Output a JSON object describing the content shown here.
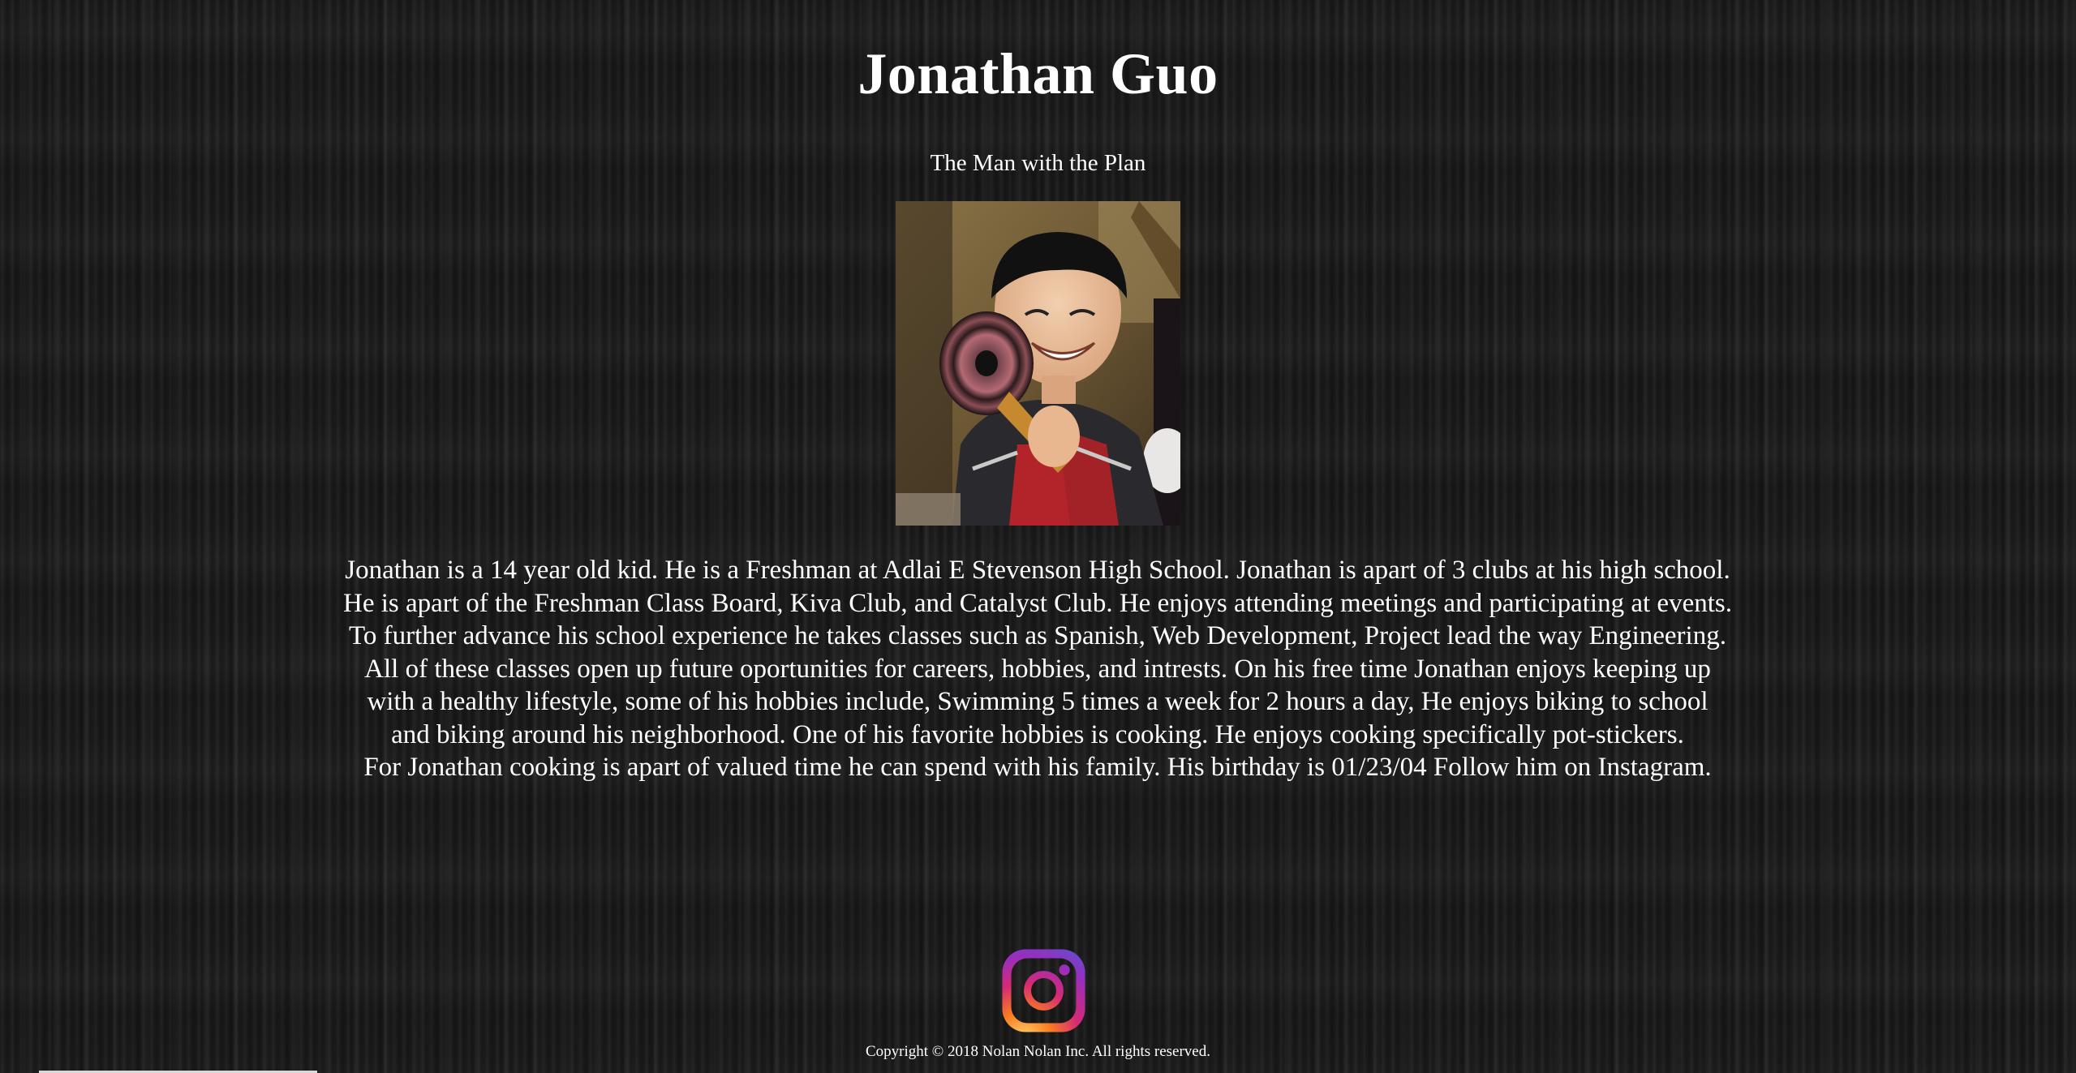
{
  "header": {
    "title": "Jonathan Guo",
    "tagline": "The Man with the Plan"
  },
  "profile": {
    "photo_icon": "profile-photo"
  },
  "bio": {
    "lines": [
      "Jonathan is a 14 year old kid. He is a Freshman at Adlai E Stevenson High School. Jonathan is apart of 3 clubs at his high school.",
      "He is apart of the Freshman Class Board, Kiva Club, and Catalyst Club. He enjoys attending meetings and participating at events.",
      "To further advance his school experience he takes classes such as Spanish, Web Development, Project lead the way Engineering.",
      "All of these classes open up future oportunities for careers, hobbies, and intrests. On his free time Jonathan enjoys keeping up",
      "with a healthy lifestyle, some of his hobbies include, Swimming 5 times a week for 2 hours a day, He enjoys biking to school",
      "and biking around his neighborhood. One of his favorite hobbies is cooking. He enjoys cooking specifically pot-stickers.",
      "For Jonathan cooking is apart of valued time he can spend with his family. His birthday is 01/23/04 Follow him on Instagram."
    ]
  },
  "footer": {
    "social_icon": "instagram-icon",
    "copyright": "Copyright © 2018 Nolan Nolan Inc. All rights reserved."
  },
  "colors": {
    "background": "#1b1b1b",
    "text": "#ffffff",
    "instagram_gradient": [
      "#feda75",
      "#fa7e1e",
      "#d62976",
      "#962fbf",
      "#4f5bd5"
    ]
  }
}
